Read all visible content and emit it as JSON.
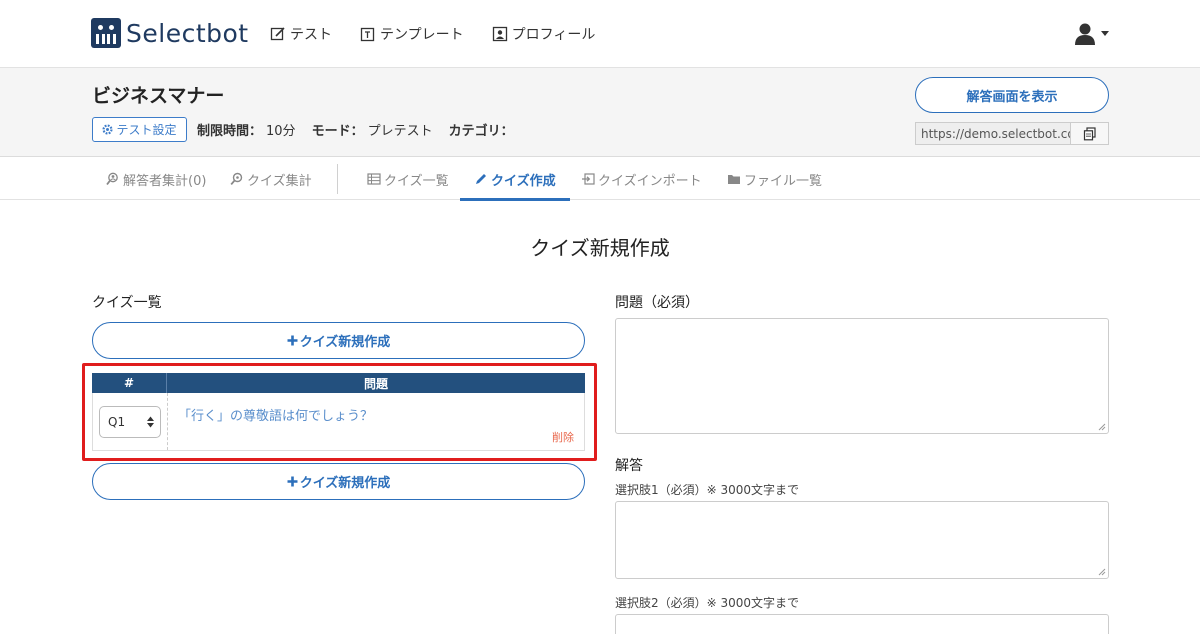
{
  "brand": {
    "name": "Selectbot",
    "color": "#1f3a60"
  },
  "nav": {
    "items": [
      {
        "label": "テスト",
        "icon": "edit-icon"
      },
      {
        "label": "テンプレート",
        "icon": "template-icon"
      },
      {
        "label": "プロフィール",
        "icon": "profile-icon"
      }
    ],
    "user_icon": "user-icon"
  },
  "test": {
    "title": "ビジネスマナー",
    "settings_label": "テスト設定",
    "time_label": "制限時間：",
    "time_value": "10分",
    "mode_label": "モード：",
    "mode_value": "プレテスト",
    "category_label": "カテゴリ：",
    "category_value": "",
    "answer_button": "解答画面を表示",
    "url": "https://demo.selectbot.co"
  },
  "tabs": [
    {
      "label": "解答者集計(0)",
      "icon": "user-search-icon"
    },
    {
      "label": "クイズ集計",
      "icon": "search-icon"
    },
    {
      "label": "クイズ一覧",
      "icon": "list-icon"
    },
    {
      "label": "クイズ作成",
      "icon": "pencil-icon",
      "active": true
    },
    {
      "label": "クイズインポート",
      "icon": "import-icon"
    },
    {
      "label": "ファイル一覧",
      "icon": "folder-icon"
    }
  ],
  "main": {
    "heading": "クイズ新規作成",
    "list_label": "クイズ一覧",
    "new_quiz_label": "クイズ新規作成",
    "table": {
      "col_num": "#",
      "col_question": "問題",
      "rows": [
        {
          "num": "Q1",
          "question": "「行く」の尊敬語は何でしょう？",
          "delete_label": "削除"
        }
      ]
    },
    "form": {
      "question_label": "問題（必須）",
      "answer_label": "解答",
      "choice1_label": "選択肢1（必須）※ 3000文字まで",
      "choice2_label": "選択肢2（必須）※ 3000文字まで"
    }
  },
  "colors": {
    "accent": "#2c6fbb",
    "table_header": "#23507e",
    "highlight": "#e01d1d",
    "danger": "#e8664a"
  }
}
